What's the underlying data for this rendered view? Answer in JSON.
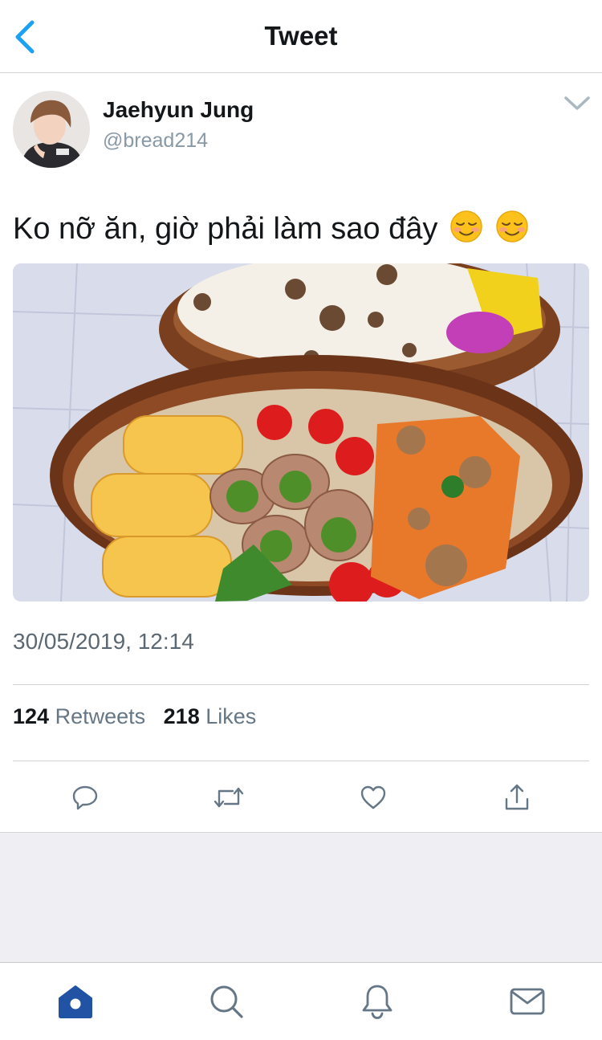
{
  "header": {
    "title": "Tweet",
    "back_icon": "chevron-left-icon"
  },
  "tweet": {
    "display_name": "Jaehyun Jung",
    "handle": "@bread214",
    "text": "Ko nỡ ăn, giờ phải làm sao đây",
    "emojis": [
      "smiling-face-icon",
      "smiling-face-icon"
    ],
    "timestamp": "30/05/2019, 12:14",
    "retweets_count": "124",
    "retweets_label": "Retweets",
    "likes_count": "218",
    "likes_label": "Likes"
  },
  "actions": [
    "reply-icon",
    "retweet-icon",
    "like-icon",
    "share-icon"
  ],
  "tabbar": [
    "home-icon",
    "search-icon",
    "notifications-icon",
    "messages-icon"
  ],
  "colors": {
    "accent": "#1da1f2",
    "home_active": "#2152a3",
    "icon_gray": "#657786",
    "muted": "#8899a6"
  }
}
